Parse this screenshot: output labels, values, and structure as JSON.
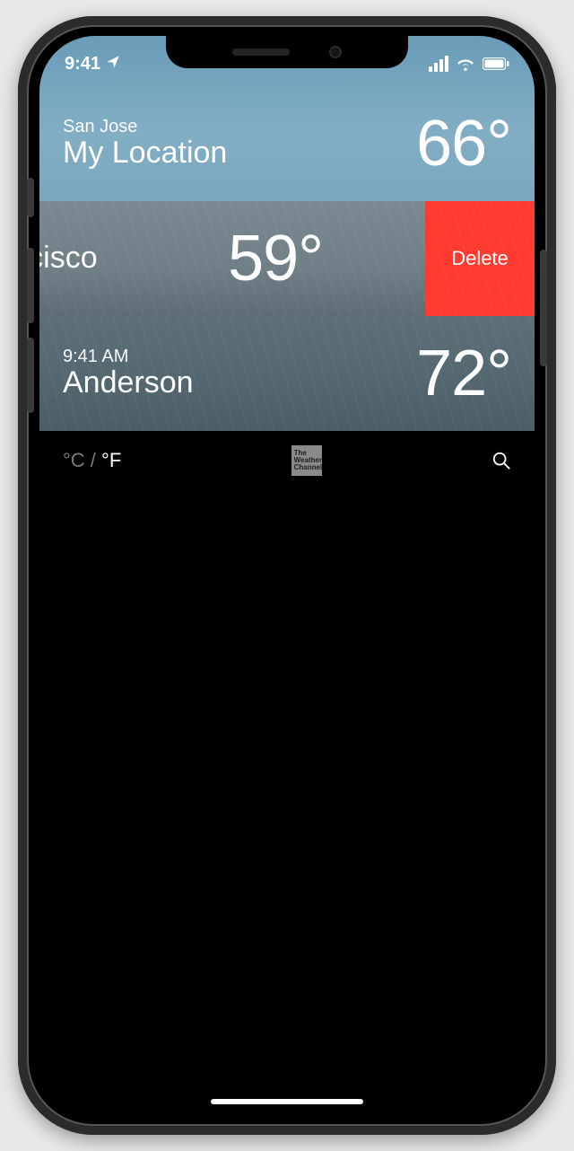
{
  "status": {
    "time": "9:41",
    "location_services": true
  },
  "cities": [
    {
      "subtitle": "San Jose",
      "title": "My Location",
      "temp": "66°"
    },
    {
      "title": "San Francisco",
      "title_cropped": "rancisco",
      "temp": "59°",
      "swiped": true,
      "delete_label": "Delete"
    },
    {
      "subtitle": "9:41 AM",
      "title": "Anderson",
      "temp": "72°"
    }
  ],
  "toolbar": {
    "unit_c": "°C",
    "unit_sep": " / ",
    "unit_f": "°F",
    "provider_line1": "The",
    "provider_line2": "Weather",
    "provider_line3": "Channel"
  }
}
